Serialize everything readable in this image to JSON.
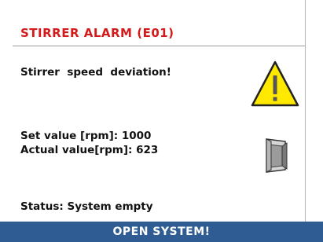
{
  "alarm": {
    "title": "STIRRER ALARM (E01)",
    "message": "Stirrer  speed  deviation!"
  },
  "values": {
    "set_label": "Set value [rpm]:",
    "set_value": "1000",
    "actual_label": "Actual value[rpm]:",
    "actual_value": "623"
  },
  "status": {
    "text": "Status: System empty"
  },
  "action": {
    "label": "OPEN  SYSTEM!"
  },
  "icons": {
    "warning": "warning-triangle-icon",
    "door": "open-door-icon"
  },
  "colors": {
    "title": "#d41a1a",
    "button": "#2f5c93",
    "warning_fill": "#ffe900"
  }
}
